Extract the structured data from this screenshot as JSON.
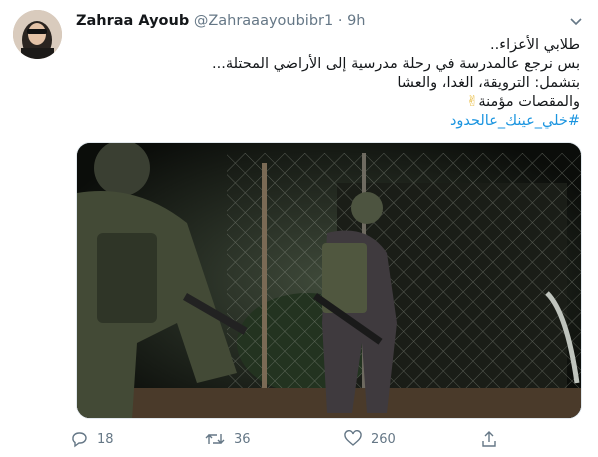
{
  "tweet": {
    "author_name": "Zahraa Ayoub",
    "author_handle": "@Zahraaayoubibr1",
    "separator": "·",
    "timestamp": "9h",
    "text_lines": [
      "طلابي الأعزاء..",
      "بس نرجع عالمدرسة في رحلة مدرسية إلى الأراضي المحتلة...",
      "بتشمل: الترويقة، الغدا، والعشا",
      "والمقصات مؤمنة"
    ],
    "hashtag": "#خلي_عينك_عالحدود",
    "emoji": "✌",
    "media": {
      "description_icon": "photo"
    }
  },
  "actions": {
    "reply_count": "18",
    "retweet_count": "36",
    "like_count": "260"
  },
  "icons": {
    "caret": "chevron-down-icon",
    "reply": "reply-icon",
    "retweet": "retweet-icon",
    "like": "heart-icon",
    "share": "share-icon"
  },
  "colors": {
    "link": "#1b95e0",
    "secondary_text": "#657786",
    "primary_text": "#14171a"
  }
}
